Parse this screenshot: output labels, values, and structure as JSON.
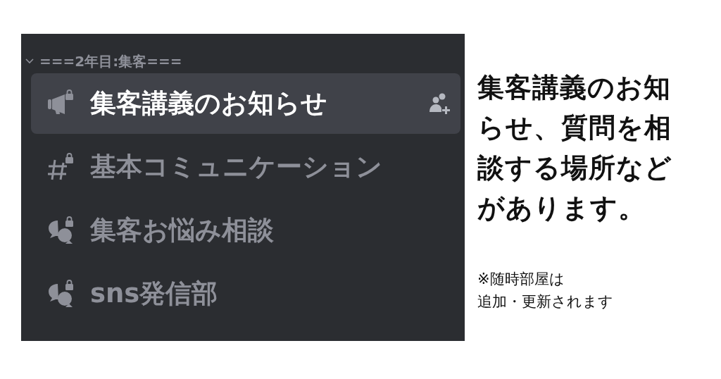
{
  "sidebar": {
    "category": {
      "label": "===2年目:集客===",
      "expanded": true
    },
    "channels": [
      {
        "kind": "announcement",
        "name": "集客講義のお知らせ",
        "selected": true
      },
      {
        "kind": "text",
        "name": "基本コミュニケーション",
        "selected": false
      },
      {
        "kind": "forum",
        "name": "集客お悩み相談",
        "selected": false
      },
      {
        "kind": "forum",
        "name": "sns発信部",
        "selected": false
      }
    ]
  },
  "caption": "集客講義のお知らせ、質問を相談する場所などがあります。",
  "note": [
    "※随時部屋は",
    "追加・更新されます"
  ]
}
